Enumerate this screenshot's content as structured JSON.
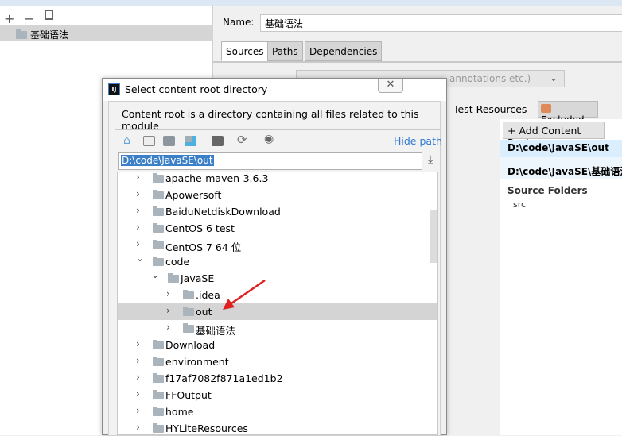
{
  "left": {
    "toolbar": {
      "add": "+",
      "remove": "−",
      "copy": "copy-icon"
    },
    "module": "基础语法"
  },
  "module_settings": {
    "name_label": "Name:",
    "name_value": "基础语法",
    "tabs": [
      {
        "label": "Sources",
        "active": true
      },
      {
        "label": "Paths"
      },
      {
        "label": "Dependencies"
      }
    ],
    "language_level_visible": "annotations etc.)",
    "mark_as": [
      "Test Resources",
      "Excluded"
    ],
    "add_content_root": "+ Add Content Root",
    "roots": [
      "D:\\code\\JavaSE\\out",
      "D:\\code\\JavaSE\\基础语法"
    ],
    "source_folders_label": "Source Folders",
    "source_folders": [
      "src"
    ]
  },
  "dialog": {
    "title": "Select content root directory",
    "close": "✕",
    "description": "Content root is a directory containing all files related to this module",
    "hide_path": "Hide path",
    "path": "D:\\code\\JavaSE\\out",
    "tree": [
      {
        "label": "apache-maven-3.6.3",
        "level": 0,
        "expanded": false
      },
      {
        "label": "Apowersoft",
        "level": 0,
        "expanded": false
      },
      {
        "label": "BaiduNetdiskDownload",
        "level": 0,
        "expanded": false
      },
      {
        "label": "CentOS 6 test",
        "level": 0,
        "expanded": false
      },
      {
        "label": "CentOS 7 64 位",
        "level": 0,
        "expanded": false
      },
      {
        "label": "code",
        "level": 0,
        "expanded": true
      },
      {
        "label": "JavaSE",
        "level": 1,
        "expanded": true
      },
      {
        "label": ".idea",
        "level": 2,
        "expanded": false
      },
      {
        "label": "out",
        "level": 2,
        "expanded": false,
        "selected": true
      },
      {
        "label": "基础语法",
        "level": 2,
        "expanded": false
      },
      {
        "label": "Download",
        "level": 0,
        "expanded": false
      },
      {
        "label": "environment",
        "level": 0,
        "expanded": false
      },
      {
        "label": "f17af7082f871a1ed1b2",
        "level": 0,
        "expanded": false
      },
      {
        "label": "FFOutput",
        "level": 0,
        "expanded": false
      },
      {
        "label": "home",
        "level": 0,
        "expanded": false
      },
      {
        "label": "HYLiteResources",
        "level": 0,
        "expanded": false
      }
    ]
  },
  "colors": {
    "selection": "#3a7fc8",
    "link": "#2f7bd1",
    "annotation_arrow": "#e02020",
    "excluded": "#e08a5a"
  }
}
